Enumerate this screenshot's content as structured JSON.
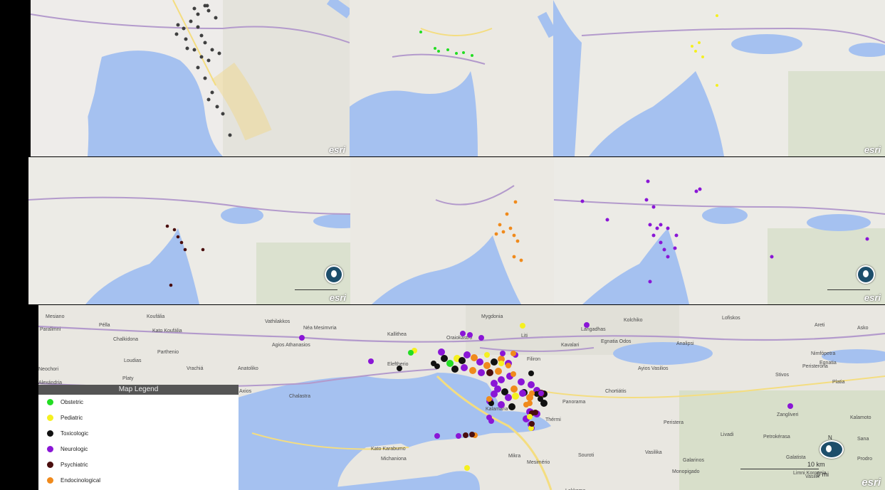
{
  "colors": {
    "obstetric": "#22dd22",
    "pediatric": "#f5f020",
    "toxicologic": "#111111",
    "neurologic": "#8a16d6",
    "psychiatric": "#4a0e0e",
    "endocrinological": "#f08a1c",
    "gray_marker": "#3f3f3f",
    "water": "#a5c1f0",
    "land": "#eeecea"
  },
  "legend": {
    "title": "Map Legend",
    "items": [
      {
        "label": "Obstetric",
        "color": "#22dd22"
      },
      {
        "label": "Pediatric",
        "color": "#f5f020"
      },
      {
        "label": "Toxicologic",
        "color": "#111111"
      },
      {
        "label": "Neurologic",
        "color": "#8a16d6"
      },
      {
        "label": "Psychiatric",
        "color": "#4a0e0e"
      },
      {
        "label": "Endocinological",
        "color": "#f08a1c"
      }
    ]
  },
  "attribution": "esri",
  "north_label": "N",
  "scale": {
    "value": "10 km",
    "secondary": "5 mi"
  },
  "main_map_labels": [
    "Mesiano",
    "Koufália",
    "Vathilakkos",
    "Mygdonia",
    "Kolchiko",
    "Lofiskos",
    "Areti",
    "Asko",
    "Paralimni",
    "Pélla",
    "Kato Koufália",
    "Néa Mesimvria",
    "Kallithea",
    "Oraiokastro",
    "Liti",
    "Langadhas",
    "Chalkidona",
    "Agios Athanasios",
    "Kavalari",
    "Egnatia Odos",
    "Analipsi",
    "Parthenio",
    "Filiron",
    "Nimfópetra",
    "Egnatia",
    "Loudias",
    "Eleftherio",
    "Neochori",
    "Vrachiá",
    "Anatoliko",
    "Ayios Vasilios",
    "Peristerona",
    "Alexándria",
    "Platy",
    "Stivos",
    "Platia",
    "Axios",
    "Chalastra",
    "Chortiátis",
    "Panorama",
    "Thérmi",
    "Zangliveri",
    "Kalamoto",
    "Kalamaria",
    "Peristera",
    "Livadi",
    "Petrokérasa",
    "Sana",
    "Kato Karabumo",
    "Galatista",
    "Michaniona",
    "Mikra",
    "Souroti",
    "Vasilika",
    "Galarinos",
    "Prodro",
    "Monopigado",
    "Vasilik",
    "Mesimério",
    "Lakkoma",
    "Limni Koroneia"
  ]
}
